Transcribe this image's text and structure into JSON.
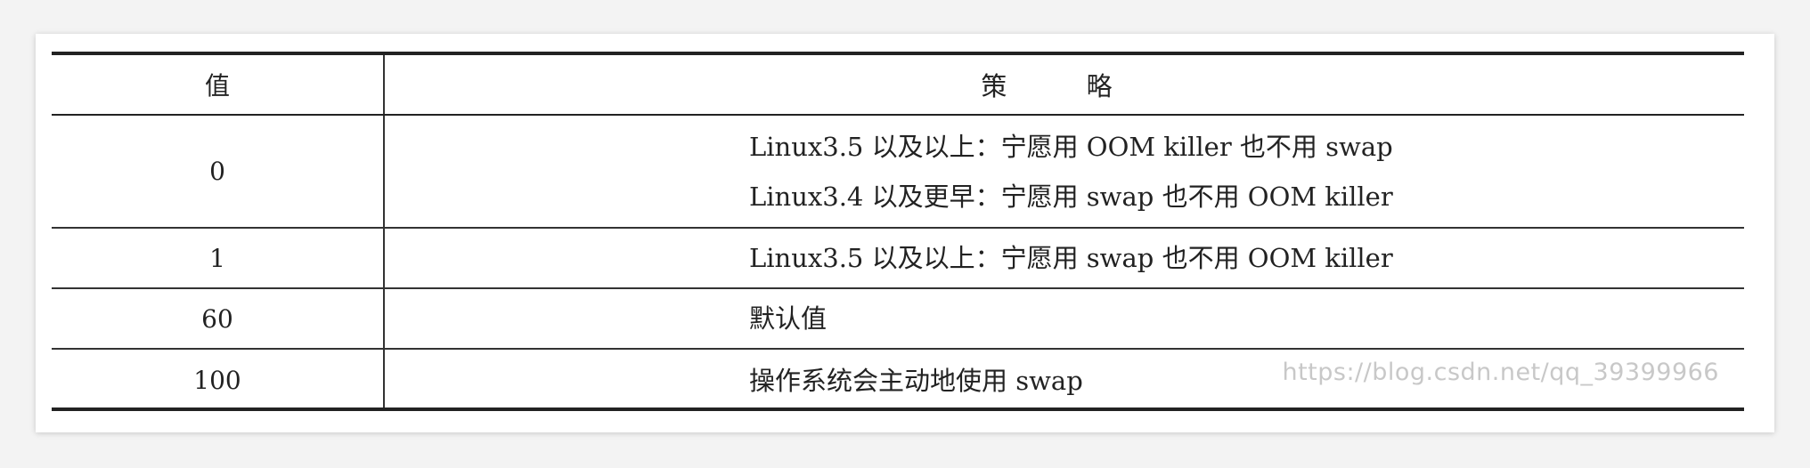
{
  "table": {
    "headers": {
      "value": "值",
      "strategy": "策  略"
    },
    "rows": [
      {
        "value": "0",
        "strategy": [
          "Linux3.5 以及以上：宁愿用 OOM killer 也不用 swap",
          "Linux3.4 以及更早：宁愿用 swap 也不用 OOM killer"
        ]
      },
      {
        "value": "1",
        "strategy": [
          "Linux3.5 以及以上：宁愿用 swap 也不用 OOM killer"
        ]
      },
      {
        "value": "60",
        "strategy": [
          "默认值"
        ]
      },
      {
        "value": "100",
        "strategy": [
          "操作系统会主动地使用 swap"
        ]
      }
    ]
  },
  "watermark": "https://blog.csdn.net/qq_39399966"
}
